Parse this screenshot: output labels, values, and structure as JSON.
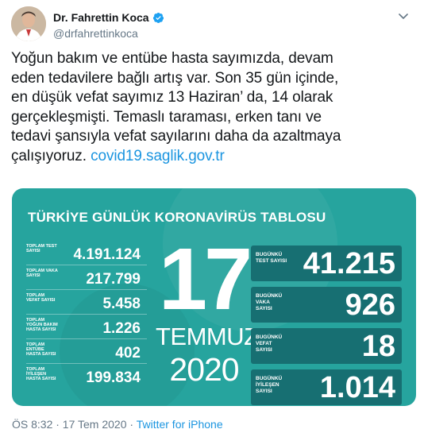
{
  "author": {
    "name": "Dr. Fahrettin Koca",
    "handle": "@drfahrettinkoca"
  },
  "tweet": {
    "lines": [
      "Yoğun bakım ve entübe hasta sayımızda, devam",
      "eden tedavilere bağlı artış var. Son 35 gün içinde,",
      "en düşük vefat sayımız 13 Haziran’   da, 14 olarak",
      "gerçekleşmişti. Temaslı taraması, erken tanı ve",
      "tedavi şansıyla vefat sayılarını daha da azaltmaya",
      "çalışıyoruz."
    ],
    "link": "covid19.saglik.gov.tr"
  },
  "card": {
    "title": "TÜRKİYE GÜNLÜK KORONAVİRÜS TABLOSU",
    "totals": [
      {
        "label": "TOPLAM TEST SAYISI",
        "value": "4.191.124"
      },
      {
        "label": "TOPLAM VAKA SAYISI",
        "value": "217.799"
      },
      {
        "label": "TOPLAM VEFAT SAYISI",
        "value": "5.458"
      },
      {
        "label": "TOPLAM YOĞUN BAKIM HASTA SAYISI",
        "value": "1.226"
      },
      {
        "label": "TOPLAM ENTÜBE HASTA SAYISI",
        "value": "402"
      },
      {
        "label": "TOPLAM İYİLEŞEN HASTA SAYISI",
        "value": "199.834"
      }
    ],
    "day": "17",
    "month": "TEMMUZ",
    "year": "2020",
    "today": [
      {
        "label": "BUGÜNKÜ TEST SAYISI",
        "value": "41.215"
      },
      {
        "label": "BUGÜNKÜ VAKA SAYISI",
        "value": "926"
      },
      {
        "label": "BUGÜNKÜ VEFAT SAYISI",
        "value": "18"
      },
      {
        "label": "BUGÜNKÜ İYİLEŞEN SAYISI",
        "value": "1.014"
      }
    ]
  },
  "footer": {
    "time": "ÖS 8:32 · 17 Tem 2020 · ",
    "source": "Twitter for iPhone"
  },
  "icons": {
    "verified": "verified-badge-icon",
    "chevron": "chevron-down-icon"
  },
  "colors": {
    "card": "#26a49e",
    "today_box": "#176f72",
    "link": "#1b95e0",
    "muted": "#657786"
  }
}
